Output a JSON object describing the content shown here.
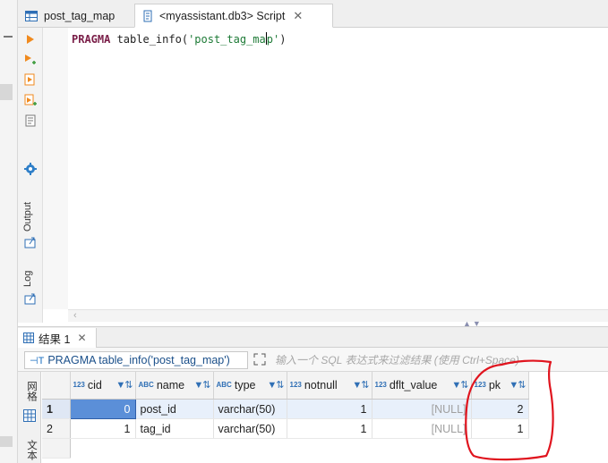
{
  "tabs": [
    {
      "label": "post_tag_map",
      "icon": "table-icon",
      "active": false
    },
    {
      "label": "<myassistant.db3> Script",
      "icon": "script-icon",
      "active": true,
      "closable": true
    }
  ],
  "editor": {
    "keyword": "PRAGMA",
    "code_mid": " table_info(",
    "string_before_caret": "'post_tag_ma",
    "string_after_caret": "p'",
    "code_end": ")"
  },
  "side_panel": {
    "output_label": "Output",
    "log_label": "Log"
  },
  "results": {
    "tab_label": "结果 1",
    "query_text": "PRAGMA table_info('post_tag_map')",
    "filter_placeholder": "输入一个 SQL 表达式来过滤结果 (使用 Ctrl+Space)",
    "view_labels": {
      "grid": "网格",
      "text": "文本"
    },
    "columns": [
      {
        "name": "cid",
        "type_icon": "123"
      },
      {
        "name": "name",
        "type_icon": "ABC"
      },
      {
        "name": "type",
        "type_icon": "ABC"
      },
      {
        "name": "notnull",
        "type_icon": "123"
      },
      {
        "name": "dflt_value",
        "type_icon": "123"
      },
      {
        "name": "pk",
        "type_icon": "123"
      }
    ],
    "rows": [
      {
        "rownum": "1",
        "cid": "0",
        "name": "post_id",
        "type": "varchar(50)",
        "notnull": "1",
        "dflt_value": "[NULL]",
        "pk": "2"
      },
      {
        "rownum": "2",
        "cid": "1",
        "name": "tag_id",
        "type": "varchar(50)",
        "notnull": "1",
        "dflt_value": "[NULL]",
        "pk": "1"
      }
    ]
  },
  "colors": {
    "accent": "#5b8fd8",
    "annotation": "#e0141e",
    "keyword": "#7a1e48",
    "string": "#1d7a36"
  }
}
